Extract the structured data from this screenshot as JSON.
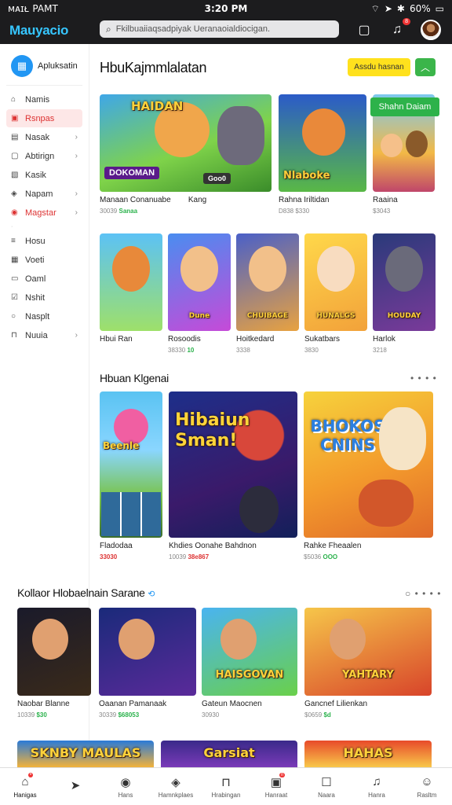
{
  "status": {
    "carrier": "ᴍᴀɪᴌ PAMT",
    "time": "3:20 PM",
    "battery": "60%"
  },
  "header": {
    "logo": "Mauyacio",
    "search_placeholder": "Fkilbuaiiaqsadpiyak Ueranaoialdiocigan.",
    "notif_badge": "8",
    "icons": [
      "search-icon",
      "clipboard-icon",
      "bell-icon",
      "avatar"
    ]
  },
  "sidebar": {
    "header_label": "Apluksatin",
    "items": [
      {
        "label": "Namis",
        "icon": "home-icon",
        "state": "normal",
        "chevron": false
      },
      {
        "label": "Rsnpas",
        "icon": "store-icon",
        "state": "active",
        "chevron": false
      },
      {
        "label": "Nasak",
        "icon": "calendar-icon",
        "state": "normal",
        "chevron": true
      },
      {
        "label": "Abtirign",
        "icon": "box-icon",
        "state": "normal",
        "chevron": true
      },
      {
        "label": "Kasik",
        "icon": "doc-icon",
        "state": "normal",
        "chevron": false
      },
      {
        "label": "Napam",
        "icon": "tag-icon",
        "state": "normal",
        "chevron": true
      },
      {
        "label": "Magstar",
        "icon": "game-icon",
        "state": "red",
        "chevron": true
      },
      {
        "label": "Hosu",
        "icon": "list-icon",
        "state": "normal",
        "chevron": false
      },
      {
        "label": "Voeti",
        "icon": "grid-icon",
        "state": "normal",
        "chevron": false
      },
      {
        "label": "Oaml",
        "icon": "note-icon",
        "state": "normal",
        "chevron": false
      },
      {
        "label": "Nshit",
        "icon": "check-icon",
        "state": "normal",
        "chevron": false
      },
      {
        "label": "Nasplt",
        "icon": "circle-icon",
        "state": "normal",
        "chevron": false
      },
      {
        "label": "Nuuia",
        "icon": "bag-icon",
        "state": "normal",
        "chevron": true
      }
    ]
  },
  "main": {
    "title": "HbuKajmmlalatan",
    "yellow_button": "Assdu hasnan",
    "green_button_icon": "chevron-up-icon",
    "hero_badge": "Shahn Daiam",
    "row1": [
      {
        "title": "Manaan Conanuabe",
        "meta_a": "30039",
        "meta_b": "Sanaa",
        "overlay": "HAIDAN",
        "chip": "DOKOMAN",
        "corner": "Goo0"
      },
      {
        "title": "Kang",
        "meta_a": "",
        "meta_b": "",
        "overlay": "",
        "chip": "",
        "corner": ""
      },
      {
        "title": "Rahna Iriltidan",
        "meta_a": "D838 $330",
        "meta_b": "",
        "overlay": "Nlaboke",
        "chip": "",
        "corner": ""
      },
      {
        "title": "Raaina",
        "meta_a": "$3043",
        "meta_b": "",
        "overlay": "",
        "chip": "",
        "corner": ""
      }
    ],
    "row2": [
      {
        "title": "Hbui Ran",
        "meta_a": "",
        "meta_b": "",
        "overlay": ""
      },
      {
        "title": "Rosoodis",
        "meta_a": "38330",
        "meta_b": "10",
        "overlay": "Dune"
      },
      {
        "title": "Hoitkedard",
        "meta_a": "3338",
        "meta_b": "",
        "overlay": "CHUIBAGE"
      },
      {
        "title": "Sukatbars",
        "meta_a": "3830",
        "meta_b": "",
        "overlay": "HUNALGS"
      },
      {
        "title": "Harlok",
        "meta_a": "3218",
        "meta_b": "",
        "overlay": "HOUDAY"
      }
    ],
    "section2": {
      "title": "Hbuan Klgenai",
      "more": "• • • •"
    },
    "row3": [
      {
        "title": "Fladodaa",
        "meta_a": "33030",
        "meta_b": "",
        "meta_red": true,
        "overlay": "Beenle"
      },
      {
        "title": "Khdies Oonahe Bahdnon",
        "meta_a": "10039",
        "meta_b": "38e867",
        "meta_red": true,
        "overlay": "Hibaiun Sman!"
      },
      {
        "title": "Rahke Fheaalen",
        "meta_a": "$5036",
        "meta_b": "OOO",
        "meta_red": false,
        "overlay": "BHOKOS CNINS"
      }
    ],
    "section3": {
      "title": "Kollaor Hlobaelnain Sarane",
      "more": "○ • • • •"
    },
    "row4": [
      {
        "title": "Naobar Blanne",
        "meta_a": "10339",
        "meta_b": "$30",
        "overlay": ""
      },
      {
        "title": "Oaanan Pamanaak",
        "meta_a": "30339",
        "meta_b": "$68053",
        "overlay": ""
      },
      {
        "title": "Gateun Maocnen",
        "meta_a": "30930",
        "meta_b": "",
        "overlay": "HAISGOVAN"
      },
      {
        "title": "Gancnef Lilienkan",
        "meta_a": "$0659",
        "meta_b": "$d",
        "overlay": "YAHTARY"
      }
    ],
    "row5_overlays": [
      "SKNBY MAULAS",
      "Garsiat",
      "HAHAS"
    ]
  },
  "bottom_nav": [
    {
      "label": "Hanigas",
      "icon": "home-icon",
      "badge": "•"
    },
    {
      "label": "",
      "icon": "arrow-icon",
      "badge": ""
    },
    {
      "label": "Hans",
      "icon": "game-icon",
      "badge": ""
    },
    {
      "label": "Hamnkplaes",
      "icon": "tag-icon",
      "badge": ""
    },
    {
      "label": "Hrabingan",
      "icon": "bag-icon",
      "badge": ""
    },
    {
      "label": "Hanraat",
      "icon": "store-icon",
      "badge": "n"
    },
    {
      "label": "Naara",
      "icon": "chat-icon",
      "badge": ""
    },
    {
      "label": "Hanra",
      "icon": "bell-icon",
      "badge": ""
    },
    {
      "label": "Rasltm",
      "icon": "user-icon",
      "badge": ""
    }
  ]
}
